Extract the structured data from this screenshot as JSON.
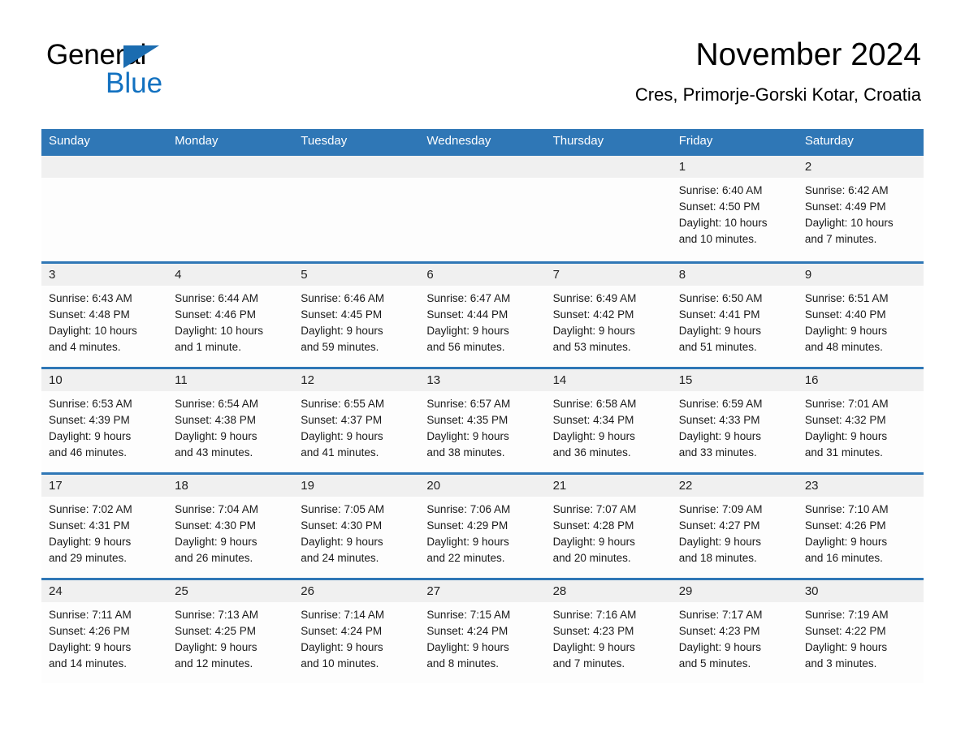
{
  "brand": {
    "name_primary": "General",
    "name_secondary": "Blue",
    "triangle_color": "#1b6cb0",
    "secondary_color": "#1271c0"
  },
  "header": {
    "title": "November 2024",
    "location": "Cres, Primorje-Gorski Kotar, Croatia"
  },
  "theme": {
    "header_blue": "#2f77b6",
    "daynum_band": "#f0f0f0",
    "cell_background": "#fdfdfd"
  },
  "calendar": {
    "weekday_headers": [
      "Sunday",
      "Monday",
      "Tuesday",
      "Wednesday",
      "Thursday",
      "Friday",
      "Saturday"
    ],
    "weeks": [
      [
        {
          "day": "",
          "sunrise": "",
          "sunset": "",
          "daylight1": "",
          "daylight2": ""
        },
        {
          "day": "",
          "sunrise": "",
          "sunset": "",
          "daylight1": "",
          "daylight2": ""
        },
        {
          "day": "",
          "sunrise": "",
          "sunset": "",
          "daylight1": "",
          "daylight2": ""
        },
        {
          "day": "",
          "sunrise": "",
          "sunset": "",
          "daylight1": "",
          "daylight2": ""
        },
        {
          "day": "",
          "sunrise": "",
          "sunset": "",
          "daylight1": "",
          "daylight2": ""
        },
        {
          "day": "1",
          "sunrise": "Sunrise: 6:40 AM",
          "sunset": "Sunset: 4:50 PM",
          "daylight1": "Daylight: 10 hours",
          "daylight2": "and 10 minutes."
        },
        {
          "day": "2",
          "sunrise": "Sunrise: 6:42 AM",
          "sunset": "Sunset: 4:49 PM",
          "daylight1": "Daylight: 10 hours",
          "daylight2": "and 7 minutes."
        }
      ],
      [
        {
          "day": "3",
          "sunrise": "Sunrise: 6:43 AM",
          "sunset": "Sunset: 4:48 PM",
          "daylight1": "Daylight: 10 hours",
          "daylight2": "and 4 minutes."
        },
        {
          "day": "4",
          "sunrise": "Sunrise: 6:44 AM",
          "sunset": "Sunset: 4:46 PM",
          "daylight1": "Daylight: 10 hours",
          "daylight2": "and 1 minute."
        },
        {
          "day": "5",
          "sunrise": "Sunrise: 6:46 AM",
          "sunset": "Sunset: 4:45 PM",
          "daylight1": "Daylight: 9 hours",
          "daylight2": "and 59 minutes."
        },
        {
          "day": "6",
          "sunrise": "Sunrise: 6:47 AM",
          "sunset": "Sunset: 4:44 PM",
          "daylight1": "Daylight: 9 hours",
          "daylight2": "and 56 minutes."
        },
        {
          "day": "7",
          "sunrise": "Sunrise: 6:49 AM",
          "sunset": "Sunset: 4:42 PM",
          "daylight1": "Daylight: 9 hours",
          "daylight2": "and 53 minutes."
        },
        {
          "day": "8",
          "sunrise": "Sunrise: 6:50 AM",
          "sunset": "Sunset: 4:41 PM",
          "daylight1": "Daylight: 9 hours",
          "daylight2": "and 51 minutes."
        },
        {
          "day": "9",
          "sunrise": "Sunrise: 6:51 AM",
          "sunset": "Sunset: 4:40 PM",
          "daylight1": "Daylight: 9 hours",
          "daylight2": "and 48 minutes."
        }
      ],
      [
        {
          "day": "10",
          "sunrise": "Sunrise: 6:53 AM",
          "sunset": "Sunset: 4:39 PM",
          "daylight1": "Daylight: 9 hours",
          "daylight2": "and 46 minutes."
        },
        {
          "day": "11",
          "sunrise": "Sunrise: 6:54 AM",
          "sunset": "Sunset: 4:38 PM",
          "daylight1": "Daylight: 9 hours",
          "daylight2": "and 43 minutes."
        },
        {
          "day": "12",
          "sunrise": "Sunrise: 6:55 AM",
          "sunset": "Sunset: 4:37 PM",
          "daylight1": "Daylight: 9 hours",
          "daylight2": "and 41 minutes."
        },
        {
          "day": "13",
          "sunrise": "Sunrise: 6:57 AM",
          "sunset": "Sunset: 4:35 PM",
          "daylight1": "Daylight: 9 hours",
          "daylight2": "and 38 minutes."
        },
        {
          "day": "14",
          "sunrise": "Sunrise: 6:58 AM",
          "sunset": "Sunset: 4:34 PM",
          "daylight1": "Daylight: 9 hours",
          "daylight2": "and 36 minutes."
        },
        {
          "day": "15",
          "sunrise": "Sunrise: 6:59 AM",
          "sunset": "Sunset: 4:33 PM",
          "daylight1": "Daylight: 9 hours",
          "daylight2": "and 33 minutes."
        },
        {
          "day": "16",
          "sunrise": "Sunrise: 7:01 AM",
          "sunset": "Sunset: 4:32 PM",
          "daylight1": "Daylight: 9 hours",
          "daylight2": "and 31 minutes."
        }
      ],
      [
        {
          "day": "17",
          "sunrise": "Sunrise: 7:02 AM",
          "sunset": "Sunset: 4:31 PM",
          "daylight1": "Daylight: 9 hours",
          "daylight2": "and 29 minutes."
        },
        {
          "day": "18",
          "sunrise": "Sunrise: 7:04 AM",
          "sunset": "Sunset: 4:30 PM",
          "daylight1": "Daylight: 9 hours",
          "daylight2": "and 26 minutes."
        },
        {
          "day": "19",
          "sunrise": "Sunrise: 7:05 AM",
          "sunset": "Sunset: 4:30 PM",
          "daylight1": "Daylight: 9 hours",
          "daylight2": "and 24 minutes."
        },
        {
          "day": "20",
          "sunrise": "Sunrise: 7:06 AM",
          "sunset": "Sunset: 4:29 PM",
          "daylight1": "Daylight: 9 hours",
          "daylight2": "and 22 minutes."
        },
        {
          "day": "21",
          "sunrise": "Sunrise: 7:07 AM",
          "sunset": "Sunset: 4:28 PM",
          "daylight1": "Daylight: 9 hours",
          "daylight2": "and 20 minutes."
        },
        {
          "day": "22",
          "sunrise": "Sunrise: 7:09 AM",
          "sunset": "Sunset: 4:27 PM",
          "daylight1": "Daylight: 9 hours",
          "daylight2": "and 18 minutes."
        },
        {
          "day": "23",
          "sunrise": "Sunrise: 7:10 AM",
          "sunset": "Sunset: 4:26 PM",
          "daylight1": "Daylight: 9 hours",
          "daylight2": "and 16 minutes."
        }
      ],
      [
        {
          "day": "24",
          "sunrise": "Sunrise: 7:11 AM",
          "sunset": "Sunset: 4:26 PM",
          "daylight1": "Daylight: 9 hours",
          "daylight2": "and 14 minutes."
        },
        {
          "day": "25",
          "sunrise": "Sunrise: 7:13 AM",
          "sunset": "Sunset: 4:25 PM",
          "daylight1": "Daylight: 9 hours",
          "daylight2": "and 12 minutes."
        },
        {
          "day": "26",
          "sunrise": "Sunrise: 7:14 AM",
          "sunset": "Sunset: 4:24 PM",
          "daylight1": "Daylight: 9 hours",
          "daylight2": "and 10 minutes."
        },
        {
          "day": "27",
          "sunrise": "Sunrise: 7:15 AM",
          "sunset": "Sunset: 4:24 PM",
          "daylight1": "Daylight: 9 hours",
          "daylight2": "and 8 minutes."
        },
        {
          "day": "28",
          "sunrise": "Sunrise: 7:16 AM",
          "sunset": "Sunset: 4:23 PM",
          "daylight1": "Daylight: 9 hours",
          "daylight2": "and 7 minutes."
        },
        {
          "day": "29",
          "sunrise": "Sunrise: 7:17 AM",
          "sunset": "Sunset: 4:23 PM",
          "daylight1": "Daylight: 9 hours",
          "daylight2": "and 5 minutes."
        },
        {
          "day": "30",
          "sunrise": "Sunrise: 7:19 AM",
          "sunset": "Sunset: 4:22 PM",
          "daylight1": "Daylight: 9 hours",
          "daylight2": "and 3 minutes."
        }
      ]
    ]
  }
}
